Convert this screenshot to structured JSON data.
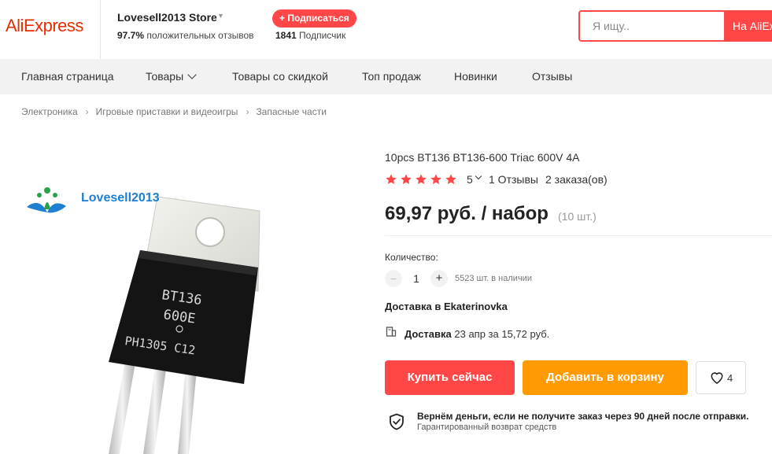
{
  "header": {
    "logo": "AliExpress",
    "store_name": "Lovesell2013 Store",
    "positive_percent": "97.7%",
    "positive_label": "положительных отзывов",
    "subscribe_label": "+ Подписаться",
    "followers_count": "1841",
    "followers_label": "Подписчик",
    "search_placeholder": "Я ищу..",
    "search_button": "На AliExpress"
  },
  "nav": {
    "items": [
      "Главная страница",
      "Товары",
      "Товары со скидкой",
      "Топ продаж",
      "Новинки",
      "Отзывы"
    ]
  },
  "breadcrumb": [
    "Электроника",
    "Игровые приставки и видеоигры",
    "Запасные части"
  ],
  "product": {
    "image": {
      "watermark": "Lovesell2013",
      "marking_line1": "BT136",
      "marking_line2": "600E",
      "marking_line3": "PH1305 C12"
    },
    "title": "10pcs BT136 BT136-600 Triac 600V 4A",
    "rating": "5",
    "star_count": 5,
    "reviews": "1 Отзывы",
    "orders": "2 заказа(ов)",
    "price": "69,97 руб. / набор",
    "price_qty": "(10 шт.)",
    "quantity_label": "Количество:",
    "quantity_value": "1",
    "quantity_minus": "−",
    "quantity_plus": "+",
    "stock": "5523 шт. в наличии",
    "delivery_to": "Доставка в Ekaterinovka",
    "shipping_label": "Доставка",
    "shipping_detail": "23 апр за 15,72 руб.",
    "buy_now": "Купить сейчас",
    "add_to_cart": "Добавить в корзину",
    "wishlist_count": "4",
    "guarantee_title": "Вернём деньги, если не получите заказ через 90 дней после отправки.",
    "guarantee_sub": "Гарантированный возврат средств"
  },
  "colors": {
    "brand_red": "#ff4747",
    "logo_red": "#e62e04",
    "cart_orange": "#ff9a00",
    "star": "#ff4747",
    "nav_bg": "#f2f2f2"
  },
  "icons": [
    "heart-icon",
    "shield-check-icon",
    "shipping-icon",
    "chevron-down-icon",
    "star-icon",
    "triangle-down-icon"
  ]
}
